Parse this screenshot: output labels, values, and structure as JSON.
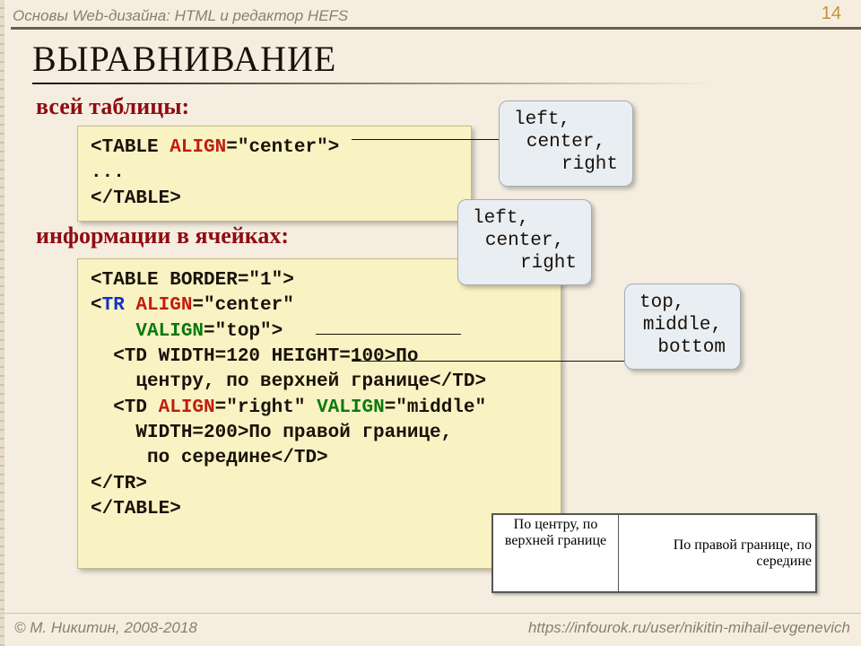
{
  "header": {
    "course": "Основы Web-дизайна: HTML и редактор HEFS",
    "page_number": "14",
    "title": "ВЫРАВНИВАНИЕ"
  },
  "section1": {
    "heading": "всей таблицы:",
    "code": {
      "lt1": "<",
      "tag1": "TABLE ",
      "attr1": "ALIGN",
      "rest1": "=\"center\">",
      "line2": "...",
      "close": "</TABLE>"
    }
  },
  "section2": {
    "heading": "информации в ячейках:",
    "code": {
      "l1": "<TABLE BORDER=\"1\">",
      "l2a": "<",
      "l2b": "TR ",
      "l2c": "ALIGN",
      "l2d": "=\"center\"",
      "l3a": "    ",
      "l3b": "VALIGN",
      "l3c": "=\"top\">",
      "l4": "  <TD WIDTH=120 HEIGHT=100>По",
      "l5": "    центру, по верхней границе</TD>",
      "l6a": "  <TD ",
      "l6b": "ALIGN",
      "l6c": "=\"right\" ",
      "l6d": "VALIGN",
      "l6e": "=\"middle\"",
      "l7": "    WIDTH=200>По правой границе,",
      "l8": "     по середине</TD>",
      "l9": "</TR>",
      "l10": "</TABLE>"
    }
  },
  "callouts": {
    "a": {
      "l1": "left,",
      "l2": "center,",
      "l3": "right"
    },
    "b": {
      "l1": "left,",
      "l2": "center,",
      "l3": "right"
    },
    "c": {
      "l1": "top,",
      "l2": "middle,",
      "l3": "bottom"
    }
  },
  "demo_table": {
    "cell1": "По центру, по верхней границе",
    "cell2": "По правой границе, по середине"
  },
  "footer": {
    "left": "© М. Никитин, 2008-2018",
    "right": "https://infourok.ru/user/nikitin-mihail-evgenevich"
  }
}
